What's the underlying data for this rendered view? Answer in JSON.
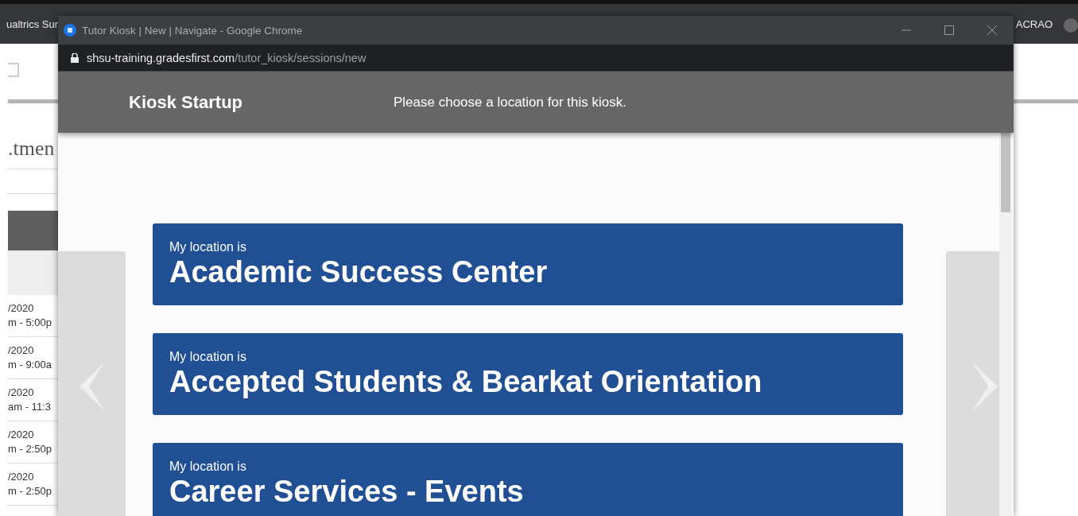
{
  "background_browser": {
    "tab_title": "ualtrics Sur",
    "profile_label": "ACRAO"
  },
  "background_page": {
    "heading": ".tmen",
    "rows": [
      {
        "date": "/2020",
        "time": "m - 5:00p"
      },
      {
        "date": "/2020",
        "time": "m - 9:00a"
      },
      {
        "date": "/2020",
        "time": "am - 11:3"
      },
      {
        "date": "/2020",
        "time": "m - 2:50p"
      },
      {
        "date": "/2020",
        "time": "m - 2:50p"
      }
    ]
  },
  "popup": {
    "title": "Tutor Kiosk | New | Navigate - Google Chrome",
    "url_host": "shsu-training.gradesfirst.com",
    "url_path": "/tutor_kiosk/sessions/new",
    "header": {
      "title": "Kiosk Startup",
      "message": "Please choose a location for this kiosk."
    },
    "locations": [
      {
        "prefix": "My location is",
        "name": "Academic Success Center"
      },
      {
        "prefix": "My location is",
        "name": "Accepted Students & Bearkat Orientation"
      },
      {
        "prefix": "My location is",
        "name": "Career Services - Events"
      }
    ]
  }
}
